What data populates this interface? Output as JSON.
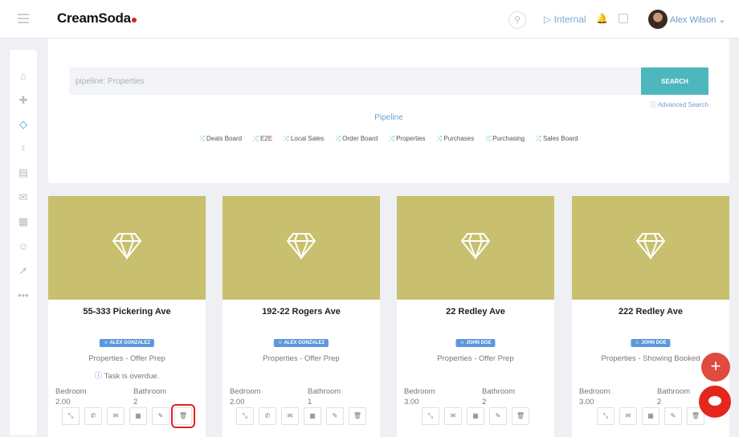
{
  "header": {
    "logo": "CreamSoda",
    "internal": "Internal",
    "user": "Alex Wilson"
  },
  "search": {
    "value": "pipeline: Properties",
    "button": "SEARCH",
    "advanced": "Advanced Search"
  },
  "pipeline": {
    "title": "Pipeline",
    "links": [
      "Deals Board",
      "E2E",
      "Local Sales",
      "Order Board",
      "Properties",
      "Purchases",
      "Purchasing",
      "Sales Board"
    ]
  },
  "cards": [
    {
      "title": "55-333 Pickering Ave",
      "agent": "ALEX GONZALEZ",
      "stage": "Properties - Offer Prep",
      "notice": "Task is overdue.",
      "bedroom_label": "Bedroom",
      "bedroom": "2.00",
      "bathroom_label": "Bathroom",
      "bathroom": "2"
    },
    {
      "title": "192-22 Rogers Ave",
      "agent": "ALEX GONZALEZ",
      "stage": "Properties - Offer Prep",
      "bedroom_label": "Bedroom",
      "bedroom": "2.00",
      "bathroom_label": "Bathroom",
      "bathroom": "1"
    },
    {
      "title": "22 Redley Ave",
      "agent": "JOHN DOE",
      "stage": "Properties - Offer Prep",
      "bedroom_label": "Bedroom",
      "bedroom": "3.00",
      "bathroom_label": "Bathroom",
      "bathroom": "2"
    },
    {
      "title": "222 Redley Ave",
      "agent": "JOHN DOE",
      "stage": "Properties - Showing Booked",
      "bedroom_label": "Bedroom",
      "bedroom": "3.00",
      "bathroom_label": "Bathroom",
      "bathroom": "2"
    }
  ],
  "colors": {
    "card_image": "#c8c06e",
    "accent": "#4eb6bd",
    "badge": "#5b97de",
    "fab": "#e04a3f"
  }
}
